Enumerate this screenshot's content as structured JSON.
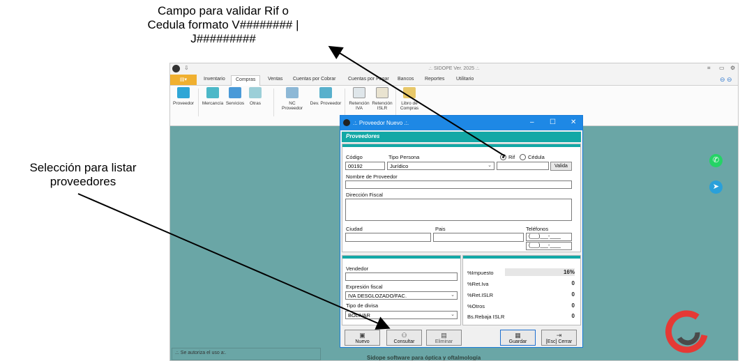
{
  "annotations": {
    "top_lines": [
      "Campo para validar Rif o",
      "Cedula formato V######## |",
      "J#########"
    ],
    "left_lines": [
      "Selección para listar",
      "proveedores"
    ]
  },
  "app": {
    "title": ".:. SIDOPE Ver. 2025 .:.",
    "tabs": [
      "Inventario",
      "Compras",
      "Ventas",
      "Cuentas por Cobrar",
      "Cuentas por Pagar",
      "Bancos",
      "Reportes",
      "Utilitario"
    ],
    "active_tab": "Compras",
    "ribbon": [
      {
        "label": "Proveedor",
        "icon": "truck-icon"
      },
      {
        "label": "Mercancía",
        "icon": "cart-icon"
      },
      {
        "label": "Servicios",
        "icon": "cart-icon"
      },
      {
        "label": "Otras",
        "icon": "cart-icon"
      },
      {
        "label": "NC Proveedor",
        "icon": "note-icon"
      },
      {
        "label": "Dev. Proveedor",
        "icon": "return-icon"
      },
      {
        "label": "Retención IVA",
        "icon": "document-icon"
      },
      {
        "label": "Retención ISLR",
        "icon": "document-icon"
      },
      {
        "label": "Libro de Compras",
        "icon": "book-icon"
      }
    ],
    "status_left": ".:. Se autoriza el uso a:.",
    "status_footer": "Sidope software para óptica y oftalmología",
    "colors": {
      "accent": "#13a8a6",
      "background": "#6aa6a6",
      "dialog_title": "#1e88e5",
      "file_tab": "#f0b030"
    }
  },
  "dialog": {
    "title": ".:. Proveedor Nuevo .:.",
    "header": "Proveedores",
    "codigo_label": "Código",
    "codigo_value": "00192",
    "tipo_label": "Tipo Persona",
    "tipo_value": "Jurídico",
    "rif_label": "Rif",
    "cedula_label": "Cédula",
    "valida_label": "Valida",
    "nombre_label": "Nombre de Proveedor",
    "direccion_label": "Dirección Fiscal",
    "ciudad_label": "Ciudad",
    "pais_label": "Pais",
    "telefonos_label": "Teléfonos",
    "phone_mask": "(___)___-____",
    "vendedor_label": "Vendedor",
    "expresion_label": "Expresión fiscal",
    "expresion_value": "IVA DESGLOZADO/FAC.",
    "divisa_label": "Tipo de divisa",
    "divisa_value": "BOLIVAR",
    "tax_rows": [
      {
        "label": "%Impuesto",
        "value": "16%"
      },
      {
        "label": "%Ret.Iva",
        "value": "0"
      },
      {
        "label": "%Ret.ISLR",
        "value": "0"
      },
      {
        "label": "%Otros",
        "value": "0"
      },
      {
        "label": "Bs.Rebaja ISLR",
        "value": "0"
      }
    ],
    "buttons": {
      "nuevo": "Nuevo",
      "consultar": "Consultar",
      "eliminar": "Eliminar",
      "guardar": "Guardar",
      "cerrar": "[Esc] Cerrar"
    }
  }
}
